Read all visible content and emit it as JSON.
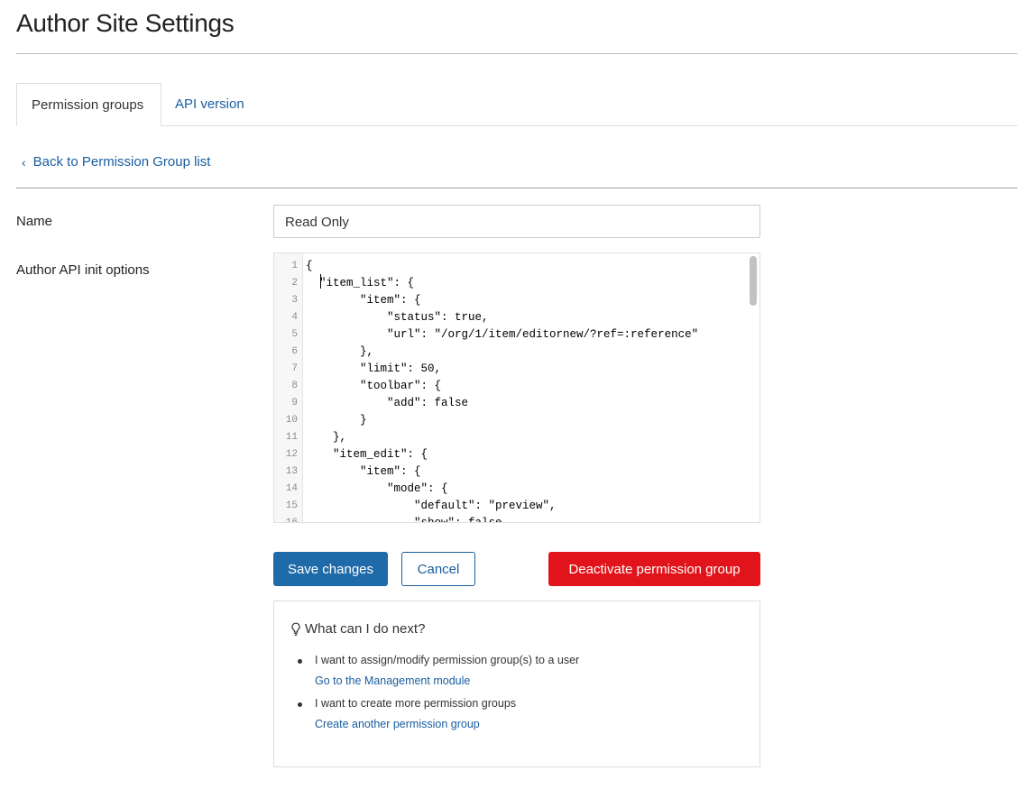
{
  "header": {
    "title": "Author Site Settings"
  },
  "tabs": [
    {
      "label": "Permission groups"
    },
    {
      "label": "API version"
    }
  ],
  "back_link": {
    "label": "Back to Permission Group list"
  },
  "form": {
    "name_label": "Name",
    "name_value": "Read Only",
    "api_label": "Author API init options"
  },
  "editor": {
    "lines": [
      "{",
      "  \"item_list\": {",
      "        \"item\": {",
      "            \"status\": true,",
      "            \"url\": \"/org/1/item/editornew/?ref=:reference\"",
      "        },",
      "        \"limit\": 50,",
      "        \"toolbar\": {",
      "            \"add\": false",
      "        }",
      "    },",
      "    \"item_edit\": {",
      "        \"item\": {",
      "            \"mode\": {",
      "                \"default\": \"preview\",",
      "                \"show\": false"
    ]
  },
  "buttons": {
    "save": "Save changes",
    "cancel": "Cancel",
    "deactivate": "Deactivate permission group"
  },
  "help": {
    "title": "What can I do next?",
    "items": [
      {
        "text": "I want to assign/modify permission group(s) to a user",
        "link": "Go to the Management module"
      },
      {
        "text": "I want to create more permission groups",
        "link": "Create another permission group"
      }
    ]
  },
  "colors": {
    "link": "#1a5ea0",
    "primary": "#1f6aa8",
    "danger": "#e2141b"
  }
}
